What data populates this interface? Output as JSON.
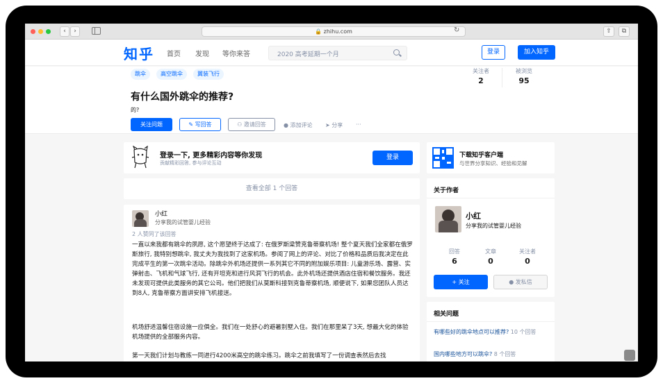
{
  "browser": {
    "url": "zhihu.com"
  },
  "header": {
    "logo": "知乎",
    "nav": [
      "首页",
      "发现",
      "等你来答"
    ],
    "search_placeholder": "2020 高考延期一个月",
    "login_label": "登录",
    "join_label": "加入知乎"
  },
  "question": {
    "tags": [
      "跳伞",
      "高空跳伞",
      "翼装飞行"
    ],
    "title": "有什么国外跳伞的推荐?",
    "description": "的?",
    "follow_label": "关注问题",
    "write_label": "写回答",
    "invite_label": "邀请回答",
    "comment_label": "添加评论",
    "share_label": "分享",
    "more_label": "···",
    "followers_label": "关注者",
    "followers": "2",
    "views_label": "被浏览",
    "views": "95"
  },
  "login_prompt": {
    "title": "登录一下, 更多精彩内容等你发现",
    "subtitle": "贡献精彩回答, 参与评论互动",
    "button": "登录"
  },
  "view_all": "查看全部 1 个回答",
  "answer": {
    "author_name": "小红",
    "author_bio": "分享我的试管婴儿经验",
    "agree_text": "2 人赞同了该回答",
    "paragraphs": [
      "一直以来我都有跳伞的夙愿, 这个愿望终于达成了: 在俄罗斯梁赞克鲁蒂察机场! 整个夏天我们全家都在俄罗斯旅行, 我特别想跳伞, 我丈夫为我找到了这家机场。参阅了网上的评论、对比了价格和品质后我决定在此完成平生的第一次跳伞活动。除跳伞外机场还提供一系列其它不同的附加娱乐项目: 儿童游乐场、露营、实弹射击、飞机和气球飞行, 还有开坦克和进行风洞飞行的机会。此外机场还提供酒店住宿和餐饮服务。我还未发现可提供此类服务的其它公司。他们把我们从莫斯科接到克鲁蒂察机场, 顺便说下, 如果您团队人员达到8人, 克鲁蒂察方面讲安排飞机接送。",
      "机场舒适温馨住宿设施一应俱全。我们在一处舒心的避暑别墅入住。我们在那里呆了3天, 想最大化的体验机场提供的全部服务内容。",
      "第一天我们计划与教练一同进行4200米高空的跳伞练习。跳伞之前我填写了一份调查表然后去找"
    ]
  },
  "app_download": {
    "title": "下载知乎客户端",
    "subtitle": "与世界分享知识、经验和见解"
  },
  "author_card": {
    "heading": "关于作者",
    "name": "小红",
    "bio": "分享我的试管婴儿经验",
    "stats": [
      {
        "label": "回答",
        "value": "6"
      },
      {
        "label": "文章",
        "value": "0"
      },
      {
        "label": "关注者",
        "value": "0"
      }
    ],
    "follow_label": "+ 关注",
    "message_label": "发私信"
  },
  "related": {
    "heading": "相关问题",
    "items": [
      {
        "title": "有哪些好的跳伞地点可以推荐?",
        "count": "10 个回答"
      },
      {
        "title": "国内哪些地方可以跳伞?",
        "count": "8 个回答"
      }
    ]
  },
  "colors": {
    "brand": "#0066ff",
    "link": "#175199",
    "muted": "#8590a6"
  }
}
